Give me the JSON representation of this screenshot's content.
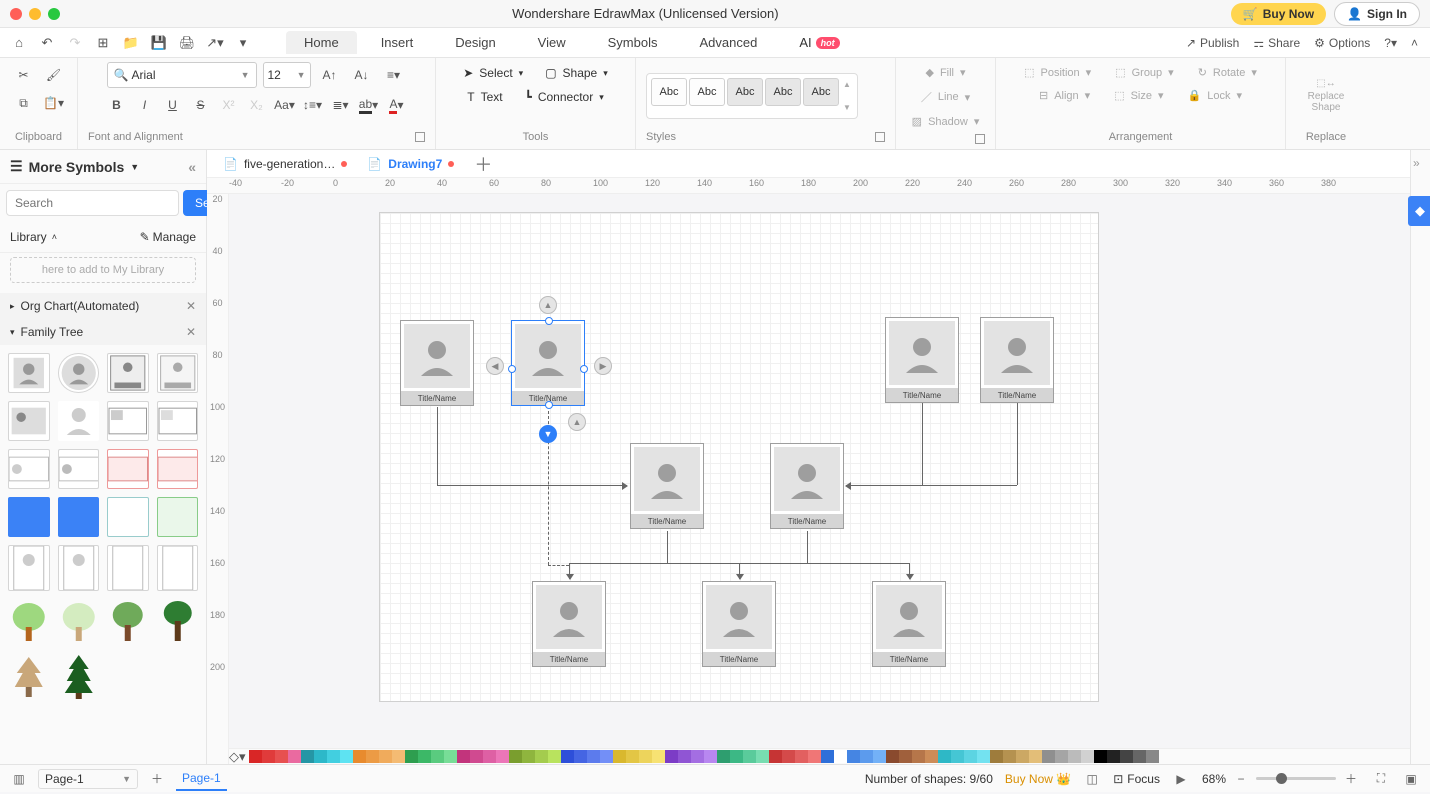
{
  "app_title": "Wondershare EdrawMax (Unlicensed Version)",
  "buy_now": "Buy Now",
  "sign_in": "Sign In",
  "menu": {
    "home": "Home",
    "insert": "Insert",
    "design": "Design",
    "view": "View",
    "symbols": "Symbols",
    "advanced": "Advanced",
    "ai": "AI",
    "hot": "hot",
    "publish": "Publish",
    "share": "Share",
    "options": "Options"
  },
  "ribbon": {
    "clipboard": "Clipboard",
    "font_name": "Arial",
    "font_size": "12",
    "font_align": "Font and Alignment",
    "select": "Select",
    "shape": "Shape",
    "text": "Text",
    "connector": "Connector",
    "tools": "Tools",
    "abc": "Abc",
    "styles": "Styles",
    "fill": "Fill",
    "line": "Line",
    "shadow": "Shadow",
    "position": "Position",
    "group": "Group",
    "rotate": "Rotate",
    "align": "Align",
    "size": "Size",
    "lock": "Lock",
    "arrangement": "Arrangement",
    "replace_shape": "Replace Shape",
    "replace": "Replace"
  },
  "sidebar": {
    "title": "More Symbols",
    "search_ph": "Search",
    "search_btn": "Search",
    "library": "Library",
    "manage": "Manage",
    "libhint": "here to add to My Library",
    "sect1": "Org Chart(Automated)",
    "sect2": "Family Tree"
  },
  "docs": {
    "tab1": "five-generation…",
    "tab2": "Drawing7"
  },
  "ruler_h": [
    "-40",
    "-20",
    "0",
    "20",
    "40",
    "60",
    "80",
    "100",
    "120",
    "140",
    "160",
    "180",
    "200",
    "220",
    "240",
    "260",
    "280",
    "300",
    "320",
    "340",
    "360",
    "380"
  ],
  "ruler_v": [
    "20",
    "40",
    "60",
    "80",
    "100",
    "120",
    "140",
    "160",
    "180",
    "200"
  ],
  "card_label": "Title/Name",
  "palette": [
    "#d92626",
    "#e03b3b",
    "#e75050",
    "#ea6aa0",
    "#2596a5",
    "#2db8c9",
    "#42cfe0",
    "#5ee3f2",
    "#e88b2e",
    "#ec9b45",
    "#f0ab5c",
    "#f4bb73",
    "#2e9e4f",
    "#3cb867",
    "#5acb7f",
    "#78dd97",
    "#c2347c",
    "#d04a90",
    "#de60a4",
    "#ec76b8",
    "#7a9e2e",
    "#8fb53e",
    "#a4cc4e",
    "#b9e35e",
    "#2e4fd9",
    "#4565e3",
    "#5c7bed",
    "#738ff7",
    "#d9b82e",
    "#e3c645",
    "#edd45c",
    "#f7e273",
    "#7c3cc6",
    "#9055d4",
    "#a46ee2",
    "#b887f0",
    "#2e9e6f",
    "#3cb885",
    "#5acb9b",
    "#78ddb1",
    "#c63434",
    "#d44a4a",
    "#e26060",
    "#f07676",
    "#2e6fd9",
    "#ffffff",
    "#4585e3",
    "#5c9bed",
    "#73b1f7",
    "#8a4a2e",
    "#a0603c",
    "#b6764a",
    "#cc8c58",
    "#2eb8c6",
    "#45c6d4",
    "#5cd4e2",
    "#73e2f0",
    "#9e7c3c",
    "#b59250",
    "#cca864",
    "#e3be78",
    "#8f8f8f",
    "#a5a5a5",
    "#bbbbbb",
    "#d1d1d1",
    "#000000",
    "#222222",
    "#444444",
    "#666666",
    "#888888"
  ],
  "status": {
    "page": "Page-1",
    "ptab": "Page-1",
    "shapes": "Number of shapes: 9/60",
    "buy": "Buy Now",
    "focus": "Focus",
    "zoom": "68%"
  }
}
